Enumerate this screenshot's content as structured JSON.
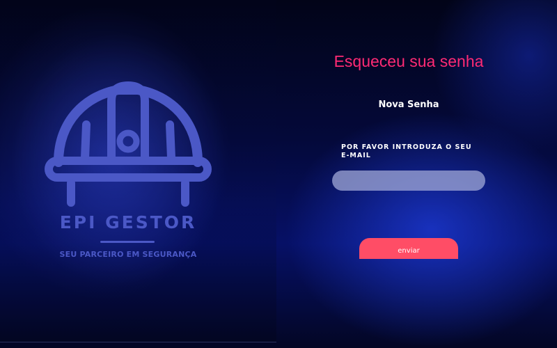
{
  "brand": {
    "name": "EPI GESTOR",
    "tagline": "SEU PARCEIRO EM SEGURANÇA",
    "logo_icon": "hard-hat-icon",
    "color": "#4b58c6"
  },
  "form": {
    "title": "Esqueceu sua senha",
    "subtitle": "Nova Senha",
    "email_label": "POR FAVOR INTRODUZA O SEU E-MAIL",
    "email_value": "",
    "submit_label": "enviar"
  },
  "colors": {
    "title": "#ff2a74",
    "button": "#ff4d66",
    "background": "#04093a"
  }
}
